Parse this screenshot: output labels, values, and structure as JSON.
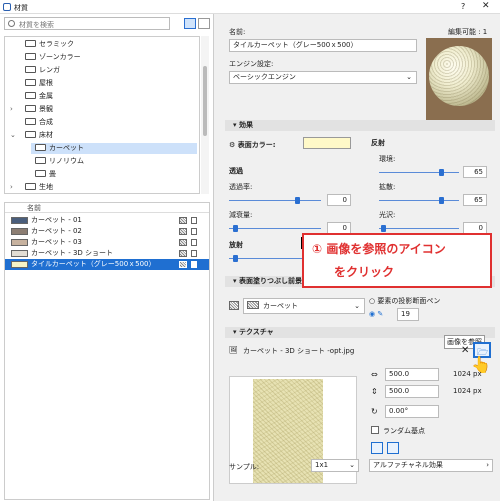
{
  "window": {
    "title": "材質",
    "help": "?",
    "close": "✕"
  },
  "left": {
    "search_placeholder": "材質を検索",
    "tree": [
      {
        "label": "セラミック",
        "indent": 1,
        "arrow": ""
      },
      {
        "label": "ゾーンカラー",
        "indent": 1,
        "arrow": ""
      },
      {
        "label": "レンガ",
        "indent": 1,
        "arrow": ""
      },
      {
        "label": "屋根",
        "indent": 1,
        "arrow": ""
      },
      {
        "label": "金属",
        "indent": 1,
        "arrow": ""
      },
      {
        "label": "景観",
        "indent": 1,
        "arrow": "›"
      },
      {
        "label": "合成",
        "indent": 1,
        "arrow": ""
      },
      {
        "label": "床材",
        "indent": 1,
        "arrow": "⌄"
      },
      {
        "label": "カーペット",
        "indent": 2,
        "arrow": "",
        "selected": true
      },
      {
        "label": "リノリウム",
        "indent": 2,
        "arrow": ""
      },
      {
        "label": "畳",
        "indent": 2,
        "arrow": ""
      },
      {
        "label": "生地",
        "indent": 1,
        "arrow": "›"
      }
    ],
    "list_header": "名前",
    "items": [
      {
        "name": "カーペット - 01",
        "color": "#4a5e7c"
      },
      {
        "name": "カーペット - 02",
        "color": "#8c7e73"
      },
      {
        "name": "カーペット - 03",
        "color": "#c7b29f"
      },
      {
        "name": "カーペット - 3D ショート",
        "color": "#e2ddd4"
      },
      {
        "name": "タイルカーペット（グレー500ｘ500）",
        "color": "#f6f4c6",
        "selected": true
      }
    ]
  },
  "right": {
    "name_label": "名前:",
    "edit_status": "編集可能 : 1",
    "name_value": "タイルカーペット（グレー500ｘ500）",
    "engine_label": "エンジン設定:",
    "engine_value": "ベーシックエンジン",
    "section_effects": "効果",
    "surface_color_label": "表面カラー:",
    "surface_color": "#fff9c8",
    "reflection_label": "反射",
    "ambient_label": "環境:",
    "ambient_value": "65",
    "diffuse_label": "拡散:",
    "diffuse_value": "65",
    "specular_label": "光沢:",
    "specular_value": "0",
    "transparency_label": "透過",
    "transmittance_label": "透過率:",
    "transmittance_value": "0",
    "attenuation_label": "減衰量:",
    "attenuation_value": "0",
    "emission_label": "放射",
    "emission_value": "0",
    "section_fill": "表面塗りつぶし前景",
    "fill_value": "カーペット",
    "fill_radio_label": "要素の投影断面ペン",
    "pen_value": "19",
    "section_texture": "テクスチャ",
    "texture_file": "カーペット - 3D ショート -opt.jpg",
    "tooltip": "画像を参照",
    "width_value": "500.0",
    "width_px": "1024 px",
    "height_value": "500.0",
    "height_px": "1024 px",
    "rotation_value": "0.00°",
    "random_origin_label": "ランダム基点",
    "sample_label": "サンプル:",
    "sample_value": "1x1",
    "alpha_value": "アルファチャネル効果"
  },
  "callout": {
    "line1": "① 画像を参照のアイコン",
    "line2": "をクリック"
  },
  "colors": {
    "accent": "#1f6fd1",
    "callout": "#e03030"
  }
}
